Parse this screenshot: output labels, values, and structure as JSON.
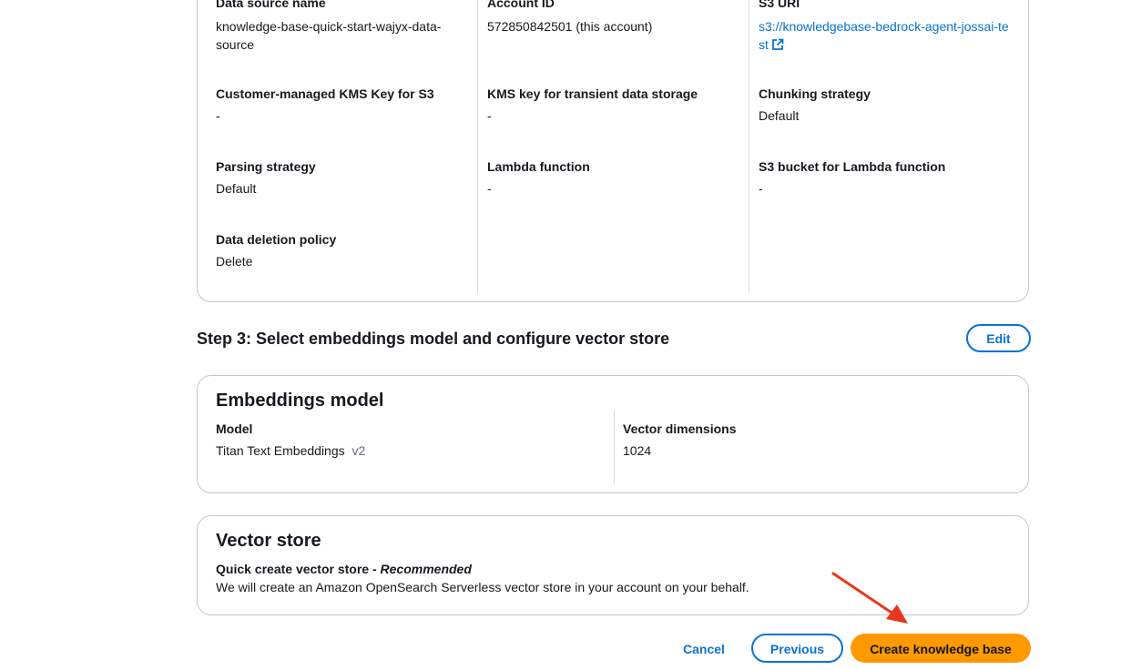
{
  "step2_card": {
    "fields": [
      {
        "label": "Data source name",
        "value": "knowledge-base-quick-start-wajyx-data-source"
      },
      {
        "label": "Account ID",
        "value": "572850842501 (this account)"
      },
      {
        "label": "S3 URI",
        "value": "s3://knowledgebase-bedrock-agent-jossai-test"
      },
      {
        "label": "Customer-managed KMS Key for S3",
        "value": "-"
      },
      {
        "label": "KMS key for transient data storage",
        "value": "-"
      },
      {
        "label": "Chunking strategy",
        "value": "Default"
      },
      {
        "label": "Parsing strategy",
        "value": "Default"
      },
      {
        "label": "Lambda function",
        "value": "-"
      },
      {
        "label": "S3 bucket for Lambda function",
        "value": "-"
      },
      {
        "label": "Data deletion policy",
        "value": "Delete"
      }
    ]
  },
  "step3": {
    "title": "Step 3: Select embeddings model and configure vector store",
    "edit_label": "Edit"
  },
  "embeddings_card": {
    "heading": "Embeddings model",
    "model_label": "Model",
    "model_value": "Titan Text Embeddings",
    "model_version": "v2",
    "dims_label": "Vector dimensions",
    "dims_value": "1024"
  },
  "vector_store_card": {
    "heading": "Vector store",
    "option_label": "Quick create vector store - ",
    "option_recommended": "Recommended",
    "description": "We will create an Amazon OpenSearch Serverless vector store in your account on your behalf."
  },
  "footer": {
    "cancel_label": "Cancel",
    "previous_label": "Previous",
    "create_label": "Create knowledge base"
  },
  "colors": {
    "primary_button": "#ff9900",
    "link": "#0972d3",
    "annotation_arrow": "#e8371e"
  }
}
